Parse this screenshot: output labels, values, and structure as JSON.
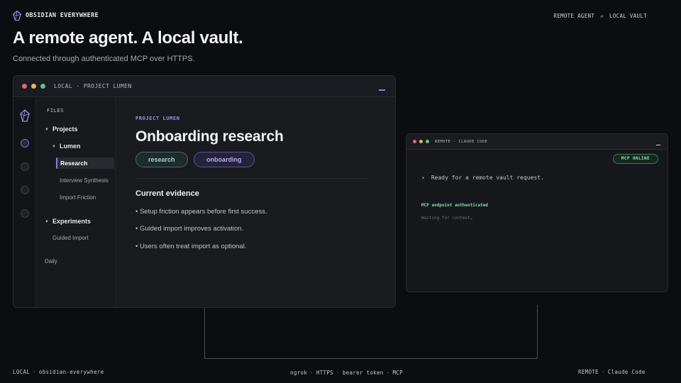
{
  "header": {
    "brand": "OBSIDIAN EVERYWHERE",
    "right_left": "REMOTE AGENT",
    "right_sep": "⇄",
    "right_right": "LOCAL VAULT"
  },
  "hero": {
    "title": "A remote agent. A local vault.",
    "subtitle": "Connected through authenticated MCP over HTTPS."
  },
  "local_window": {
    "title": "LOCAL · PROJECT LUMEN",
    "files_heading": "FILES",
    "tree": {
      "projects": "Projects",
      "lumen": "Lumen",
      "research": "Research",
      "interview": "Interview Synthesis",
      "import_friction": "Import Friction",
      "experiments": "Experiments",
      "guided_import": "Guided Import",
      "daily": "Daily"
    },
    "editor": {
      "project_label": "PROJECT LUMEN",
      "title": "Onboarding research",
      "tags": [
        "research",
        "onboarding"
      ],
      "section": "Current evidence",
      "bullets": [
        "• Setup friction appears before first success.",
        "• Guided import improves activation.",
        "• Users often treat import as optional."
      ]
    }
  },
  "remote_window": {
    "title": "REMOTE · CLAUDE CODE",
    "badge": "MCP ONLINE",
    "prompt": "›",
    "line1": "Ready for a remote vault request.",
    "auth": "MCP endpoint authenticated",
    "waiting": "Waiting for context…"
  },
  "footer": {
    "left_a": "LOCAL",
    "left_b": "obsidian-everywhere",
    "center": [
      "ngrok",
      "HTTPS",
      "bearer token",
      "MCP"
    ],
    "right_a": "REMOTE",
    "right_b": "Claude Code",
    "sep": "·"
  },
  "colors": {
    "accent": "#8f7ae6",
    "online": "#7fe0a8",
    "background": "#0c0d10"
  }
}
